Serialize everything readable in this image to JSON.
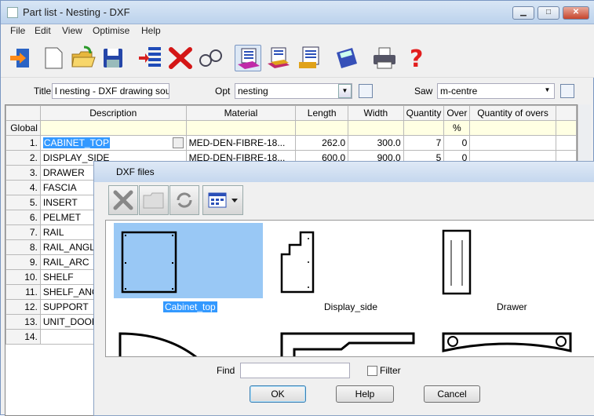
{
  "window": {
    "title": "Part list - Nesting - DXF"
  },
  "menu": [
    "File",
    "Edit",
    "View",
    "Optimise",
    "Help"
  ],
  "toolbar": {
    "icons": [
      "exit-icon",
      "new-icon",
      "open-icon",
      "save-icon",
      "insert-row-icon",
      "delete-icon",
      "find-icon",
      "parts-list-icon",
      "board-list-icon",
      "edging-list-icon",
      "calculator-icon",
      "print-icon",
      "help-icon"
    ]
  },
  "options": {
    "title_label": "Title",
    "title_value": "l nesting - DXF drawing source",
    "opt_label": "Opt",
    "opt_value": "nesting",
    "saw_label": "Saw",
    "saw_value": "m-centre"
  },
  "grid": {
    "columns": [
      "Description",
      "Material",
      "Length",
      "Width",
      "Quantity",
      "Over",
      "Quantity of overs"
    ],
    "global_label": "Global",
    "global_over": "%",
    "rows": [
      {
        "num": "1.",
        "desc": "CABINET_TOP",
        "mat": "MED-DEN-FIBRE-18...",
        "len": "262.0",
        "wid": "300.0",
        "qty": "7",
        "over": "0"
      },
      {
        "num": "2.",
        "desc": "DISPLAY_SIDE",
        "mat": "MED-DEN-FIBRE-18...",
        "len": "600.0",
        "wid": "900.0",
        "qty": "5",
        "over": "0"
      },
      {
        "num": "3.",
        "desc": "DRAWER"
      },
      {
        "num": "4.",
        "desc": "FASCIA"
      },
      {
        "num": "5.",
        "desc": "INSERT"
      },
      {
        "num": "6.",
        "desc": "PELMET"
      },
      {
        "num": "7.",
        "desc": "RAIL"
      },
      {
        "num": "8.",
        "desc": "RAIL_ANGLE"
      },
      {
        "num": "9.",
        "desc": "RAIL_ARC"
      },
      {
        "num": "10.",
        "desc": "SHELF"
      },
      {
        "num": "11.",
        "desc": "SHELF_ANG"
      },
      {
        "num": "12.",
        "desc": "SUPPORT"
      },
      {
        "num": "13.",
        "desc": "UNIT_DOOR"
      },
      {
        "num": "14.",
        "desc": ""
      }
    ]
  },
  "dialog": {
    "title": "DXF files",
    "files": [
      "Cabinet_top",
      "Display_side",
      "Drawer"
    ],
    "find_label": "Find",
    "find_value": "",
    "filter_label": "Filter",
    "ok": "OK",
    "help": "Help",
    "cancel": "Cancel"
  }
}
